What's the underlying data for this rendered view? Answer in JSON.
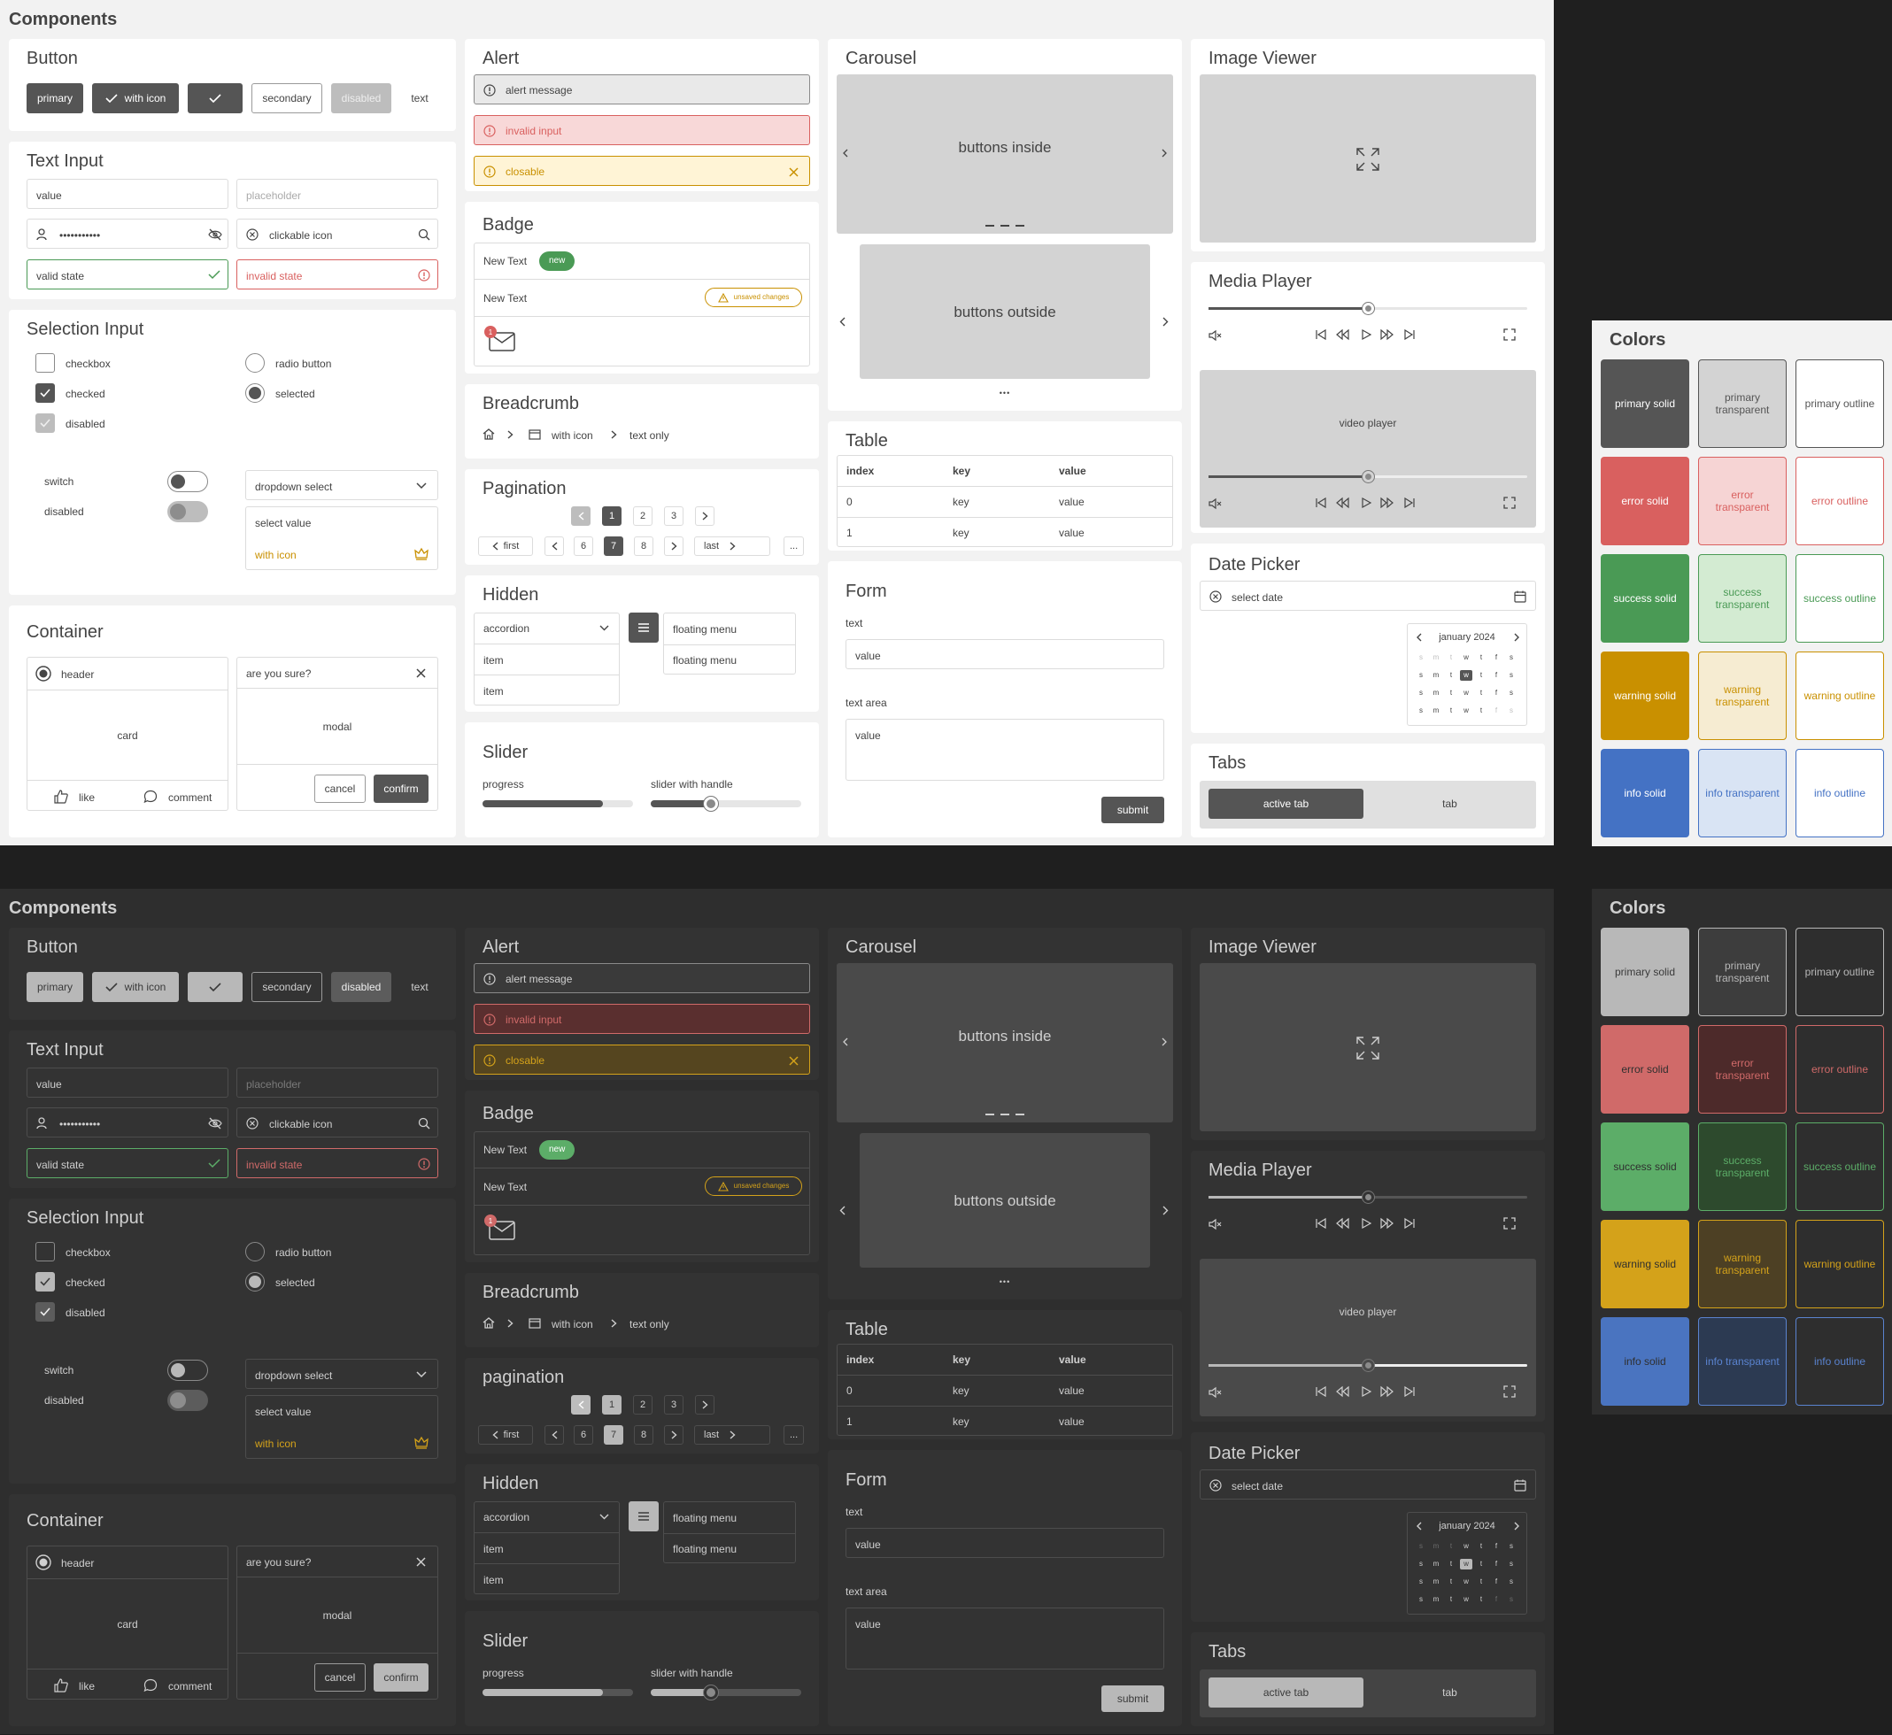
{
  "page_title": "Components",
  "button": {
    "title": "Button",
    "primary": "primary",
    "with_icon": "with icon",
    "secondary": "secondary",
    "disabled": "disabled",
    "text": "text"
  },
  "text_input": {
    "title": "Text Input",
    "value": "value",
    "placeholder": "placeholder",
    "password": "•••••••••••",
    "clickable_icon": "clickable icon",
    "valid_state": "valid state",
    "invalid_state": "invalid state"
  },
  "selection": {
    "title": "Selection Input",
    "checkbox": "checkbox",
    "checked": "checked",
    "disabled": "disabled",
    "radio_button": "radio button",
    "selected": "selected",
    "switch": "switch",
    "switch_disabled": "disabled",
    "dropdown": "dropdown select",
    "select_value": "select value",
    "with_icon": "with icon"
  },
  "container": {
    "title": "Container",
    "header": "header",
    "card": "card",
    "like": "like",
    "comment": "comment",
    "modal_title": "are you sure?",
    "modal": "modal",
    "cancel": "cancel",
    "confirm": "confirm"
  },
  "alert": {
    "title": "Alert",
    "message": "alert message",
    "invalid": "invalid input",
    "closable": "closable"
  },
  "badge": {
    "title": "Badge",
    "text1": "New Text",
    "new": "new",
    "text2": "New Text",
    "unsaved": "unsaved changes",
    "count": "1"
  },
  "breadcrumb": {
    "title": "Breadcrumb",
    "with_icon": "with icon",
    "text_only": "text only"
  },
  "pagination": {
    "title_light": "Pagination",
    "title_dark": "pagination",
    "row1": [
      "1",
      "2",
      "3"
    ],
    "first": "first",
    "row2": [
      "6",
      "7",
      "8"
    ],
    "last": "last",
    "more": "..."
  },
  "hidden": {
    "title": "Hidden",
    "accordion": "accordion",
    "item1": "item",
    "item2": "item",
    "floating1": "floating menu",
    "floating2": "floating menu"
  },
  "slider": {
    "title": "Slider",
    "progress": "progress",
    "handle": "slider with handle",
    "progress_value": 0.8,
    "handle_value": 0.4
  },
  "carousel": {
    "title": "Carousel",
    "inside": "buttons inside",
    "outside": "buttons outside",
    "dots": "•••"
  },
  "table": {
    "title": "Table",
    "headers": [
      "index",
      "key",
      "value"
    ],
    "rows": [
      [
        "0",
        "key",
        "value"
      ],
      [
        "1",
        "key",
        "value"
      ]
    ]
  },
  "form": {
    "title": "Form",
    "text_label": "text",
    "text_value": "value",
    "area_label": "text area",
    "area_value": "value",
    "submit": "submit"
  },
  "image_viewer": {
    "title": "Image Viewer"
  },
  "media_player": {
    "title": "Media Player",
    "video": "video player",
    "audio_progress": 0.5,
    "video_progress": 0.5
  },
  "date_picker": {
    "title": "Date Picker",
    "placeholder": "select date",
    "month": "january 2024",
    "rows": [
      [
        "s",
        "m",
        "t",
        "w",
        "t",
        "f",
        "s"
      ],
      [
        "s",
        "m",
        "t",
        "w",
        "t",
        "f",
        "s"
      ],
      [
        "s",
        "m",
        "t",
        "w",
        "t",
        "f",
        "s"
      ],
      [
        "s",
        "m",
        "t",
        "w",
        "t",
        "f",
        "s"
      ]
    ]
  },
  "tabs": {
    "title": "Tabs",
    "active": "active tab",
    "tab": "tab"
  },
  "colors": {
    "title": "Colors",
    "items": [
      {
        "label": "primary solid",
        "light": "#555555",
        "dark": "#b8b8b8",
        "style": "solid"
      },
      {
        "label": "primary transparent",
        "light": "#d3d3d3",
        "dark": "#3d3d3d",
        "style": "transparent"
      },
      {
        "label": "primary outline",
        "light": "#555555",
        "dark": "#b8b8b8",
        "style": "outline"
      },
      {
        "label": "error solid",
        "light": "#d9605f",
        "dark": "#d06a69",
        "style": "solid"
      },
      {
        "label": "error transparent",
        "light": "#f6d4d4",
        "dark": "#4d2a2a",
        "style": "transparent"
      },
      {
        "label": "error outline",
        "light": "#d9605f",
        "dark": "#d06a69",
        "style": "outline"
      },
      {
        "label": "success solid",
        "light": "#4a9a55",
        "dark": "#5cad68",
        "style": "solid"
      },
      {
        "label": "success transparent",
        "light": "#d3ebd2",
        "dark": "#2d4a2d",
        "style": "transparent"
      },
      {
        "label": "success outline",
        "light": "#4a9a55",
        "dark": "#5cad68",
        "style": "outline"
      },
      {
        "label": "warning solid",
        "light": "#c99000",
        "dark": "#d4a21a",
        "style": "solid"
      },
      {
        "label": "warning transparent",
        "light": "#f6ecd2",
        "dark": "#4d4024",
        "style": "transparent"
      },
      {
        "label": "warning outline",
        "light": "#c99000",
        "dark": "#d4a21a",
        "style": "outline"
      },
      {
        "label": "info solid",
        "light": "#4472c4",
        "dark": "#4a74c0",
        "style": "solid"
      },
      {
        "label": "info transparent",
        "light": "#d9e4f4",
        "dark": "#2c3a52",
        "style": "transparent"
      },
      {
        "label": "info outline",
        "light": "#4472c4",
        "dark": "#5a83cf",
        "style": "outline"
      }
    ]
  }
}
